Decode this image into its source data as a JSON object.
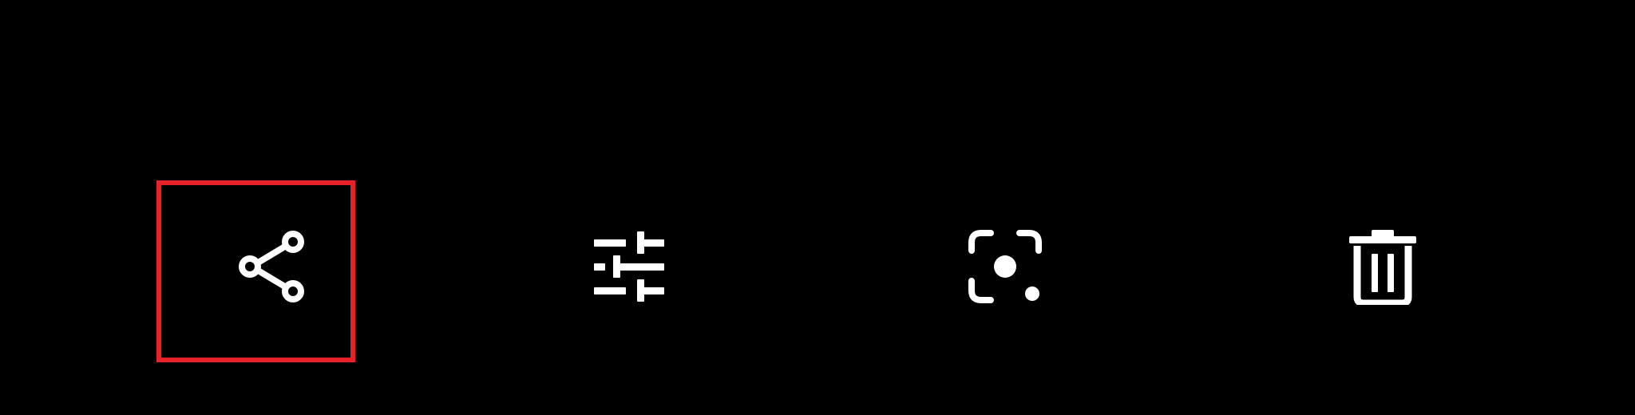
{
  "toolbar": {
    "items": [
      {
        "id": "share",
        "icon": "share-icon"
      },
      {
        "id": "adjust",
        "icon": "sliders-icon"
      },
      {
        "id": "lens",
        "icon": "lens-icon"
      },
      {
        "id": "delete",
        "icon": "trash-icon"
      }
    ],
    "highlight_target": "share"
  },
  "colors": {
    "background": "#000000",
    "icon": "#ffffff",
    "highlight": "#e8222a"
  }
}
